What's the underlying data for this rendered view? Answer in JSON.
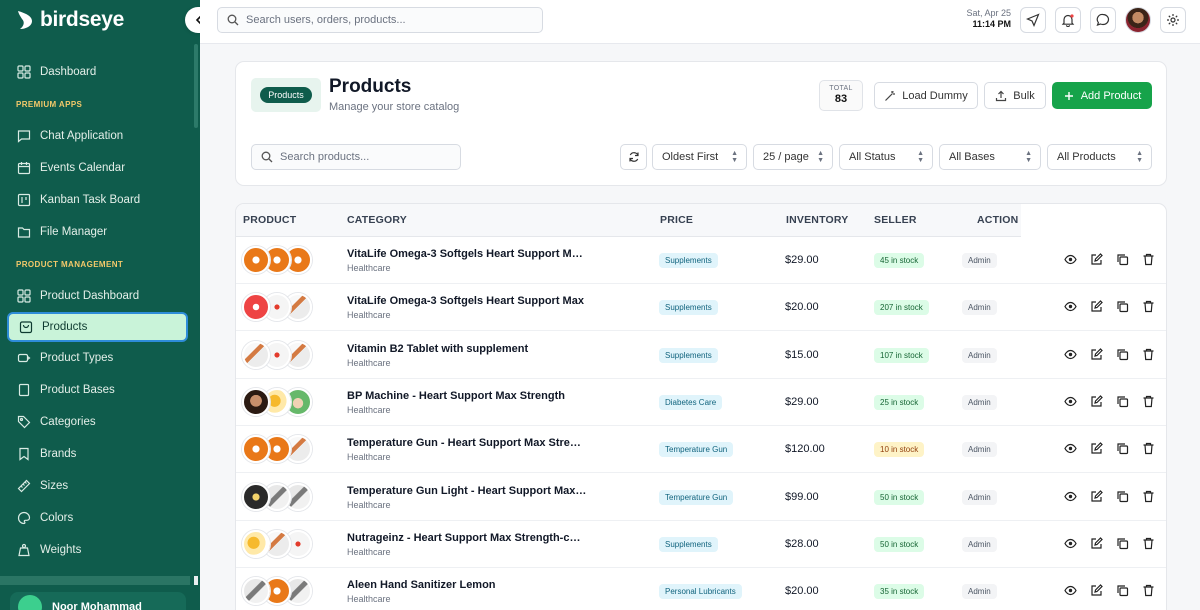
{
  "app": {
    "logo_text": "birdseye"
  },
  "sidebar": {
    "dashboard": "Dashboard",
    "premium_label": "PREMIUM APPS",
    "premium_items": [
      "Chat Application",
      "Events Calendar",
      "Kanban Task Board",
      "File Manager"
    ],
    "product_label": "PRODUCT MANAGEMENT",
    "product_items": [
      "Product Dashboard",
      "Products",
      "Product Types",
      "Product Bases",
      "Categories",
      "Brands",
      "Sizes",
      "Colors",
      "Weights"
    ],
    "user_name": "Noor Mohammad"
  },
  "topbar": {
    "search_placeholder": "Search users, orders, products...",
    "date": "Sat, Apr 25",
    "time": "11:14 PM"
  },
  "header": {
    "crumb": "Products",
    "title": "Products",
    "subtitle": "Manage your store catalog",
    "total_label": "TOTAL",
    "total_value": "83",
    "load_dummy": "Load Dummy",
    "bulk": "Bulk",
    "add_product": "Add Product"
  },
  "filters": {
    "search_placeholder": "Search products...",
    "sort": "Oldest First",
    "per_page": "25 / page",
    "status": "All Status",
    "bases": "All Bases",
    "products": "All Products"
  },
  "table": {
    "headers": [
      "PRODUCT",
      "CATEGORY",
      "PRICE",
      "INVENTORY",
      "SELLER",
      "ACTION"
    ],
    "rows": [
      {
        "name": "VitaLife Omega-3 Softgels Heart Support Max...",
        "sub": "Healthcare",
        "category": "Supplements",
        "price": "$29.00",
        "stock": "45 in stock",
        "stock_level": "ok",
        "seller": "Admin",
        "thumbs": [
          "t-orange",
          "t-orange",
          "t-orange"
        ]
      },
      {
        "name": "VitaLife Omega-3 Softgels Heart Support Max",
        "sub": "Healthcare",
        "category": "Supplements",
        "price": "$20.00",
        "stock": "207 in stock",
        "stock_level": "ok",
        "seller": "Admin",
        "thumbs": [
          "t-red",
          "t-bottle",
          "t-pack"
        ]
      },
      {
        "name": "Vitamin B2 Tablet with supplement",
        "sub": "Healthcare",
        "category": "Supplements",
        "price": "$15.00",
        "stock": "107 in stock",
        "stock_level": "ok",
        "seller": "Admin",
        "thumbs": [
          "t-pack",
          "t-bottle",
          "t-pack"
        ]
      },
      {
        "name": "BP Machine - Heart Support Max Strength",
        "sub": "Healthcare",
        "category": "Diabetes Care",
        "price": "$29.00",
        "stock": "25 in stock",
        "stock_level": "ok",
        "seller": "Admin",
        "thumbs": [
          "t-face",
          "t-fruit",
          "t-green"
        ]
      },
      {
        "name": "Temperature Gun - Heart Support Max Streng...",
        "sub": "Healthcare",
        "category": "Temperature Gun",
        "price": "$120.00",
        "stock": "10 in stock",
        "stock_level": "low",
        "seller": "Admin",
        "thumbs": [
          "t-orange",
          "t-orange",
          "t-pack"
        ]
      },
      {
        "name": "Temperature Gun Light - Heart Support Max S...",
        "sub": "Healthcare",
        "category": "Temperature Gun",
        "price": "$99.00",
        "stock": "50 in stock",
        "stock_level": "ok",
        "seller": "Admin",
        "thumbs": [
          "t-dark",
          "t-gray",
          "t-gray"
        ]
      },
      {
        "name": "Nutrageinz - Heart Support Max Strength-copy",
        "sub": "Healthcare",
        "category": "Supplements",
        "price": "$28.00",
        "stock": "50 in stock",
        "stock_level": "ok",
        "seller": "Admin",
        "thumbs": [
          "t-fruit",
          "t-pack",
          "t-bottle"
        ]
      },
      {
        "name": "Aleen Hand Sanitizer Lemon",
        "sub": "Healthcare",
        "category": "Personal Lubricants",
        "price": "$20.00",
        "stock": "35 in stock",
        "stock_level": "ok",
        "seller": "Admin",
        "thumbs": [
          "t-gray",
          "t-orange",
          "t-gray"
        ]
      }
    ]
  }
}
